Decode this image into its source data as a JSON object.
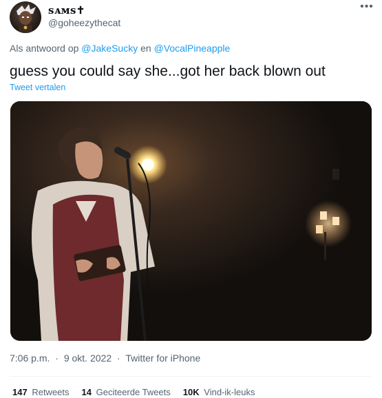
{
  "author": {
    "display_name": "ꜱᴀᴍꜱ✝",
    "handle": "@goheezythecat"
  },
  "more_icon": "more-horizontal-icon",
  "reply": {
    "prefix": "Als antwoord op",
    "user1": "@JakeSucky",
    "joiner": "en",
    "user2": "@VocalPineapple"
  },
  "tweet": {
    "text": "guess you could say she...got her back blown out",
    "translate": "Tweet vertalen"
  },
  "meta": {
    "time": "7:06 p.m.",
    "date": "9 okt. 2022",
    "source": "Twitter for iPhone",
    "separator": "·"
  },
  "stats": {
    "retweets_count": "147",
    "retweets_label": "Retweets",
    "quotes_count": "14",
    "quotes_label": "Geciteerde Tweets",
    "likes_count": "10K",
    "likes_label": "Vind-ik-leuks"
  },
  "colors": {
    "link": "#1d9bf0",
    "secondary": "#536471",
    "text": "#0f1419"
  }
}
